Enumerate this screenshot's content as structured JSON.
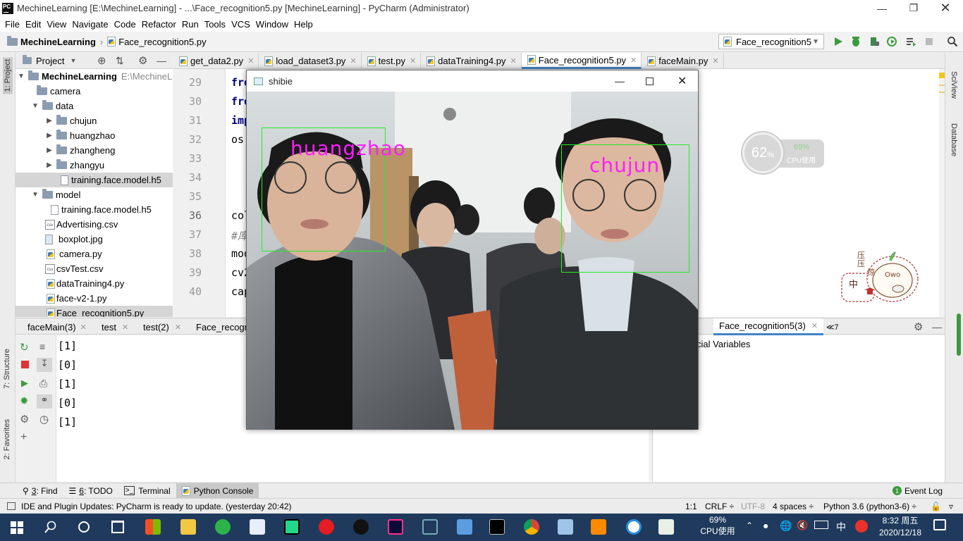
{
  "window": {
    "title": "MechineLearning [E:\\MechineLearning] - ...\\Face_recognition5.py [MechineLearning] - PyCharm (Administrator)",
    "app_icon_text": "PC"
  },
  "menu": [
    "File",
    "Edit",
    "View",
    "Navigate",
    "Code",
    "Refactor",
    "Run",
    "Tools",
    "VCS",
    "Window",
    "Help"
  ],
  "breadcrumb": {
    "project": "MechineLearning",
    "file": "Face_recognition5.py"
  },
  "run_config": "Face_recognition5",
  "project_panel": {
    "title": "Project",
    "tree": [
      {
        "label": "MechineLearning",
        "extra": "E:\\MechineL",
        "type": "folder",
        "bold": true
      },
      {
        "label": "camera",
        "type": "folder"
      },
      {
        "label": "data",
        "type": "folder"
      },
      {
        "label": "chujun",
        "type": "folder"
      },
      {
        "label": "huangzhao",
        "type": "folder"
      },
      {
        "label": "zhangheng",
        "type": "folder"
      },
      {
        "label": "zhangyu",
        "type": "folder"
      },
      {
        "label": "training.face.model.h5",
        "type": "h5"
      },
      {
        "label": "model",
        "type": "folder"
      },
      {
        "label": "training.face.model.h5",
        "type": "h5"
      },
      {
        "label": "Advertising.csv",
        "type": "csv"
      },
      {
        "label": "boxplot.jpg",
        "type": "img"
      },
      {
        "label": "camera.py",
        "type": "py"
      },
      {
        "label": "csvTest.csv",
        "type": "csv"
      },
      {
        "label": "dataTraining4.py",
        "type": "py"
      },
      {
        "label": "face-v2-1.py",
        "type": "py"
      },
      {
        "label": "Face_recognition5.py",
        "type": "py"
      }
    ]
  },
  "editor_tabs": [
    "get_data2.py",
    "load_dataset3.py",
    "test.py",
    "dataTraining4.py",
    "Face_recognition5.py",
    "faceMain.py"
  ],
  "active_tab": "Face_recognition5.py",
  "line_numbers": [
    "29",
    "30",
    "31",
    "32",
    "33",
    "34",
    "35",
    "36",
    "37",
    "38",
    "39",
    "40"
  ],
  "code_lines": [
    "fro",
    "fro",
    "imp",
    "os.",
    "",
    "",
    "",
    "col",
    "#库",
    "mod",
    "cv2",
    "cap"
  ],
  "left_stripe": {
    "project": "1: Project",
    "structure": "7: Structure",
    "favorites": "2: Favorites"
  },
  "right_stripe": {
    "sciview": "SciView",
    "database": "Database"
  },
  "console_tabs": [
    "faceMain(3)",
    "test",
    "test(2)",
    "Face_recogn"
  ],
  "console_tab_right": "Face_recognition5(3)",
  "console_tab_more": "≪7",
  "console_output": [
    "[1]",
    "[0]",
    "[1]",
    "[0]",
    "[1]"
  ],
  "variables_label": "cial Variables",
  "cpu_widget": {
    "percent": "62",
    "unit": "%",
    "cpu2": "69%",
    "cpu2_label": "CPU使用"
  },
  "sticker_text": [
    "压",
    "压",
    "惊",
    "中"
  ],
  "sticker_face": "Owo",
  "shibie": {
    "title": "shibie",
    "faces": [
      {
        "name": "huangzhao"
      },
      {
        "name": "chujun"
      }
    ]
  },
  "tool_windows": [
    {
      "num": "3",
      "label": ": Find"
    },
    {
      "num": "6",
      "label": ": TODO"
    },
    {
      "num": "",
      "label": "Terminal"
    },
    {
      "num": "",
      "label": "Python Console"
    }
  ],
  "event_log": "Event Log",
  "status": {
    "message": "IDE and Plugin Updates: PyCharm is ready to update. (yesterday 20:42)",
    "position": "1:1",
    "line_sep": "CRLF ÷",
    "encoding": "UTF-8",
    "indent": "4 spaces ÷",
    "interpreter": "Python 3.6 (python3-6) ÷"
  },
  "taskbar": {
    "cpu_pct": "69%",
    "cpu_label": "CPU使用",
    "ime": "中",
    "time": "8:32 周五",
    "date": "2020/12/18"
  }
}
